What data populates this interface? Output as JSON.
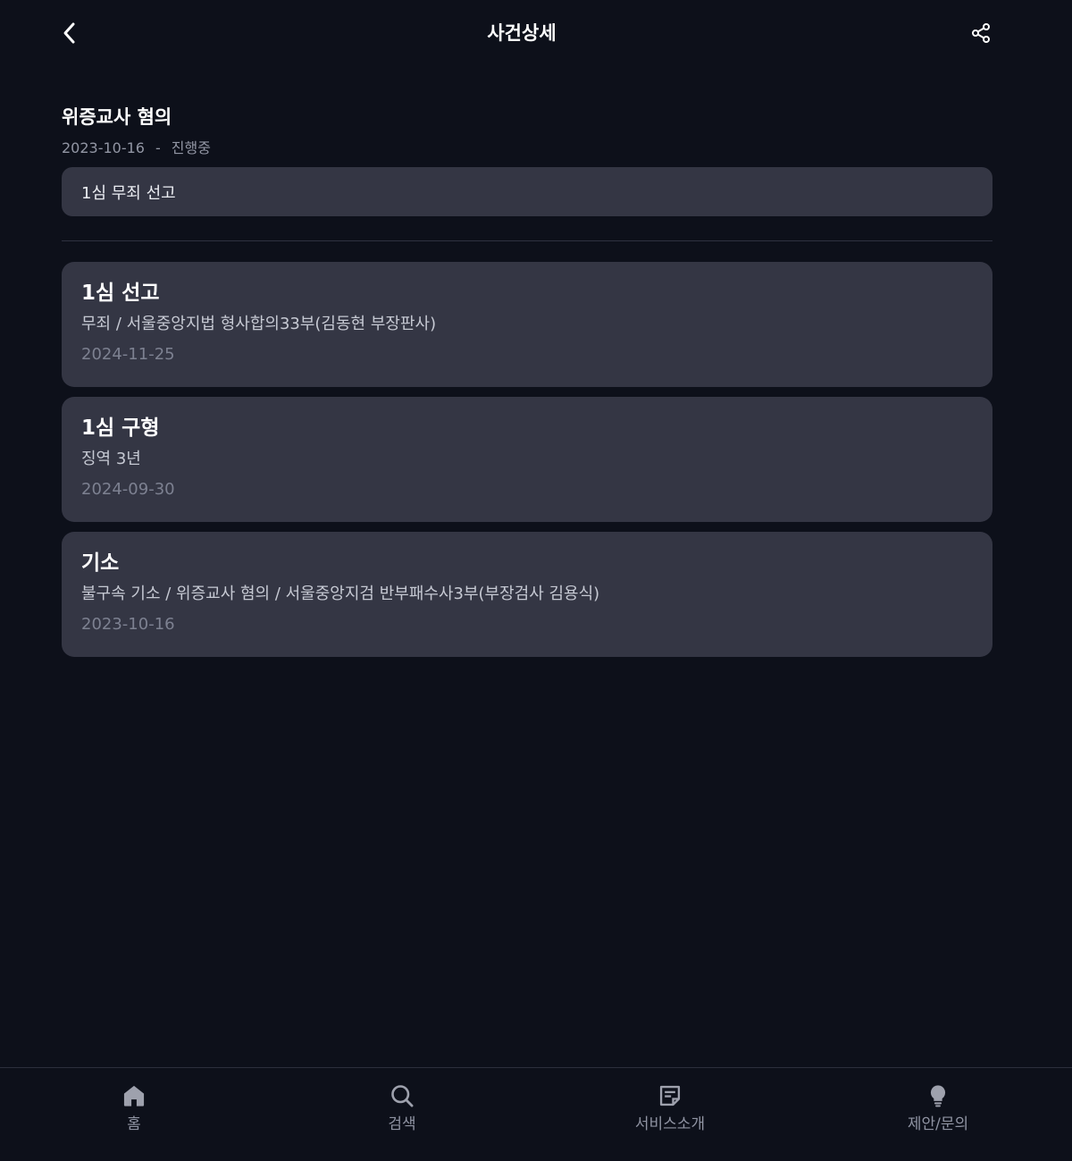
{
  "header": {
    "title": "사건상세",
    "back_icon": "chevron-left-icon",
    "share_icon": "share-icon"
  },
  "case": {
    "title": "위증교사 혐의",
    "date": "2023-10-16",
    "separator": "-",
    "status": "진행중",
    "summary": "1심 무죄 선고"
  },
  "events": [
    {
      "title": "1심 선고",
      "detail": "무죄 / 서울중앙지법 형사합의33부(김동현 부장판사)",
      "date": "2024-11-25"
    },
    {
      "title": "1심 구형",
      "detail": "징역 3년",
      "date": "2024-09-30"
    },
    {
      "title": "기소",
      "detail": "불구속 기소 / 위증교사 혐의 / 서울중앙지검 반부패수사3부(부장검사 김용식)",
      "date": "2023-10-16"
    }
  ],
  "nav": {
    "items": [
      {
        "label": "홈",
        "icon": "home-icon"
      },
      {
        "label": "검색",
        "icon": "search-icon"
      },
      {
        "label": "서비스소개",
        "icon": "document-icon"
      },
      {
        "label": "제안/문의",
        "icon": "lightbulb-icon"
      }
    ]
  },
  "colors": {
    "background": "#0d101a",
    "card": "#343644",
    "muted_text": "#9296a4",
    "nav_text": "#8f93a2"
  }
}
